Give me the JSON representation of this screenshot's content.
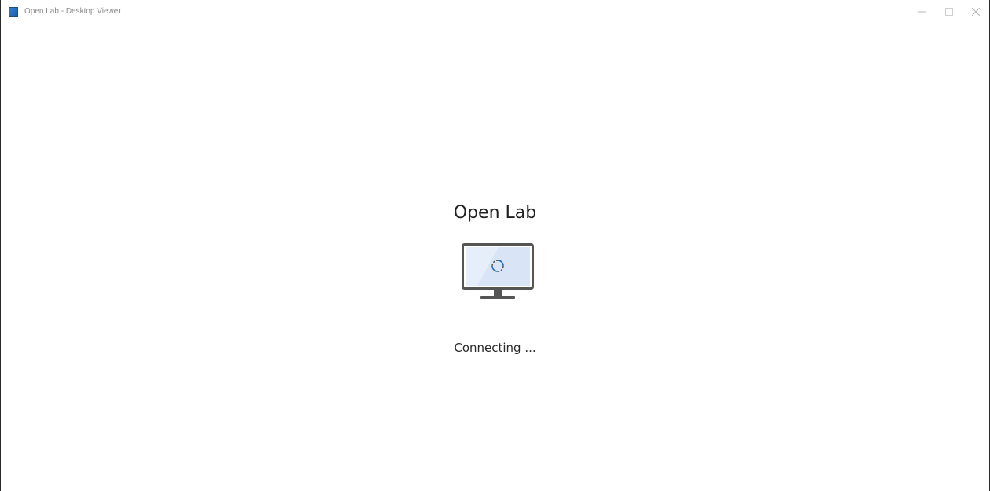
{
  "window": {
    "title": "Open Lab - Desktop Viewer",
    "icon": "app-icon",
    "controls": {
      "minimize": "minimize-icon",
      "maximize": "maximize-icon",
      "close": "close-icon"
    }
  },
  "main": {
    "app_name": "Open Lab",
    "illustration": "monitor-loading-icon",
    "status": "Connecting ..."
  },
  "colors": {
    "accent": "#1f6fc4",
    "monitor_frame": "#555555",
    "screen_fill": "#e8f0fb"
  }
}
